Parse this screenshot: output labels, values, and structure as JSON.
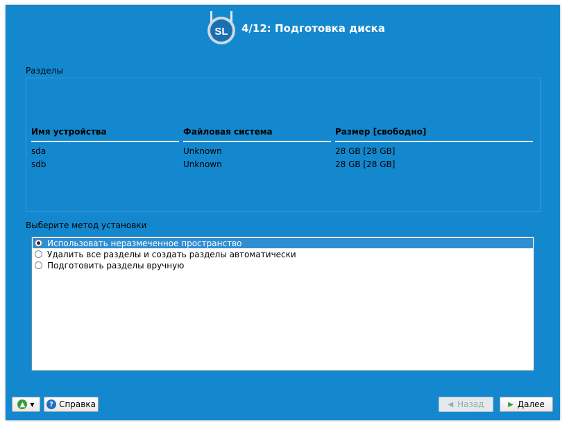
{
  "header": {
    "title": "4/12: Подготовка диска",
    "logo_text": "SL"
  },
  "partitions": {
    "label": "Разделы",
    "columns": [
      "Имя устройства",
      "Файловая система",
      "Размер [свободно]"
    ],
    "rows": [
      [
        "sda",
        "Unknown",
        "28 GB [28 GB]"
      ],
      [
        "sdb",
        "Unknown",
        "28 GB [28 GB]"
      ]
    ]
  },
  "install_method": {
    "label": "Выберите метод установки",
    "options": [
      {
        "label": "Использовать неразмеченное пространство",
        "selected": true
      },
      {
        "label": "Удалить все разделы и создать разделы автоматически",
        "selected": false
      },
      {
        "label": "Подготовить разделы вручную",
        "selected": false
      }
    ]
  },
  "footer": {
    "help_label": "Справка",
    "back_label": "Назад",
    "next_label": "Далее"
  }
}
